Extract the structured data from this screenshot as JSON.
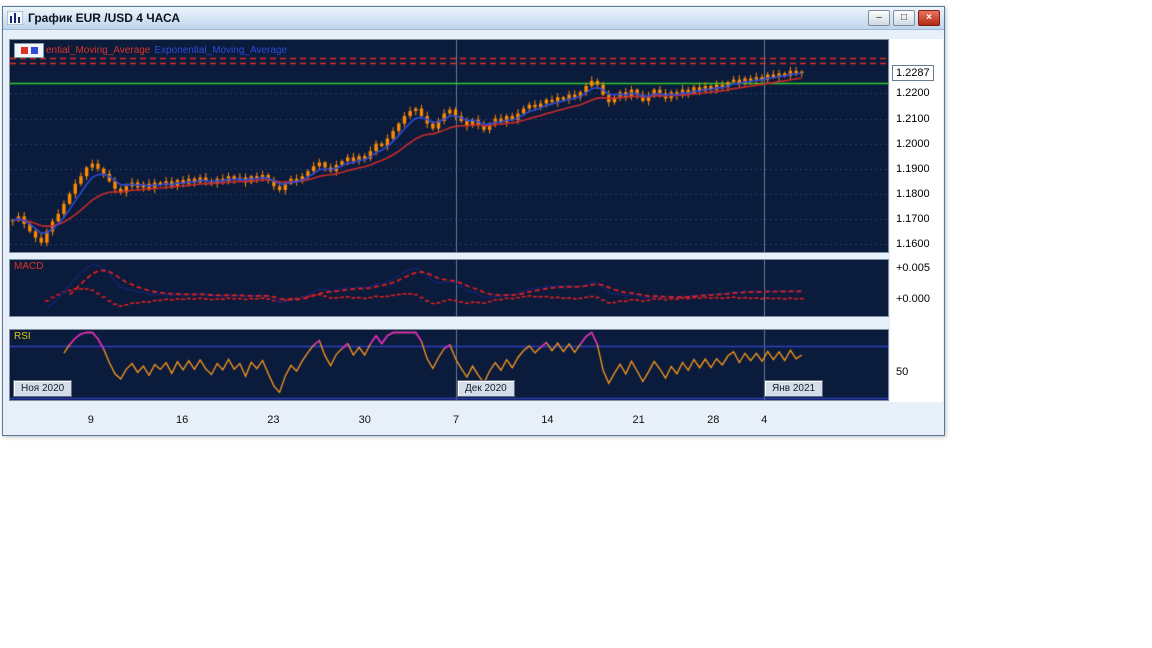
{
  "window": {
    "title": "График EUR /USD 4 ЧАСА",
    "controls": {
      "minimize": "–",
      "maximize": "□",
      "close": "×"
    }
  },
  "legend": {
    "red_label": "ential_Moving_Average",
    "blue_label": "Exponential_Moving_Average"
  },
  "panels": {
    "macd_label": "MACD",
    "rsi_label": "RSI"
  },
  "date_buttons": [
    {
      "label": "Ноя 2020"
    },
    {
      "label": "Дек 2020"
    },
    {
      "label": "Янв 2021"
    }
  ],
  "chart_data": [
    {
      "type": "candlestick",
      "title": "EUR/USD 4 часа",
      "ylim": [
        1.1568,
        1.2413
      ],
      "price_axis_labels": [
        {
          "label": "1.2287",
          "value": 1.2287,
          "current": true
        },
        {
          "label": "1.2200",
          "value": 1.22
        },
        {
          "label": "1.2100",
          "value": 1.21
        },
        {
          "label": "1.2000",
          "value": 1.2
        },
        {
          "label": "1.1900",
          "value": 1.19
        },
        {
          "label": "1.1800",
          "value": 1.18
        },
        {
          "label": "1.1700",
          "value": 1.17
        },
        {
          "label": "1.1600",
          "value": 1.16
        }
      ],
      "hlines": [
        {
          "value": 1.234,
          "color": "#e03127",
          "style": "dashed"
        },
        {
          "value": 1.232,
          "color": "#e03127",
          "style": "dashed"
        },
        {
          "value": 1.2243,
          "color": "#2fca2f",
          "style": "solid"
        }
      ],
      "month_line_fractions": [
        0.508,
        0.859
      ],
      "candles_width_fraction": 0.905,
      "first_open": 1.169,
      "close": [
        1.1695,
        1.171,
        1.168,
        1.165,
        1.1625,
        1.1605,
        1.165,
        1.169,
        1.172,
        1.176,
        1.18,
        1.184,
        1.187,
        1.1905,
        1.192,
        1.19,
        1.188,
        1.185,
        1.182,
        1.1805,
        1.183,
        1.1845,
        1.1825,
        1.184,
        1.182,
        1.1845,
        1.1835,
        1.185,
        1.183,
        1.1855,
        1.184,
        1.186,
        1.1845,
        1.1865,
        1.185,
        1.184,
        1.186,
        1.185,
        1.187,
        1.1855,
        1.1865,
        1.1845,
        1.187,
        1.186,
        1.1875,
        1.1855,
        1.183,
        1.1815,
        1.184,
        1.186,
        1.185,
        1.187,
        1.189,
        1.191,
        1.1925,
        1.1905,
        1.189,
        1.1915,
        1.193,
        1.1945,
        1.193,
        1.195,
        1.194,
        1.197,
        1.2,
        1.199,
        1.202,
        1.205,
        1.208,
        1.211,
        1.213,
        1.214,
        1.211,
        1.208,
        1.206,
        1.209,
        1.212,
        1.2135,
        1.211,
        1.209,
        1.207,
        1.2095,
        1.2075,
        1.2055,
        1.208,
        1.21,
        1.2085,
        1.211,
        1.2095,
        1.212,
        1.214,
        1.2155,
        1.2145,
        1.216,
        1.2175,
        1.2165,
        1.2185,
        1.2175,
        1.2195,
        1.2185,
        1.2205,
        1.223,
        1.225,
        1.2235,
        1.2195,
        1.2165,
        1.2185,
        1.2205,
        1.2185,
        1.2215,
        1.2195,
        1.217,
        1.219,
        1.2215,
        1.22,
        1.218,
        1.2205,
        1.219,
        1.2215,
        1.22,
        1.2225,
        1.221,
        1.223,
        1.2215,
        1.2235,
        1.2225,
        1.2245,
        1.2255,
        1.224,
        1.226,
        1.225,
        1.2265,
        1.2255,
        1.2275,
        1.2265,
        1.228,
        1.227,
        1.229,
        1.228,
        1.2287
      ],
      "x_ticks": [
        {
          "label": "9",
          "f": 0.092
        },
        {
          "label": "16",
          "f": 0.196
        },
        {
          "label": "23",
          "f": 0.3
        },
        {
          "label": "30",
          "f": 0.404
        },
        {
          "label": "7",
          "f": 0.508
        },
        {
          "label": "14",
          "f": 0.612
        },
        {
          "label": "21",
          "f": 0.716
        },
        {
          "label": "28",
          "f": 0.801
        },
        {
          "label": "4",
          "f": 0.859
        }
      ],
      "colors": {
        "bg": "#0a1b3c",
        "candle": "#ff8a00",
        "ema_fast": "#2e4bd8",
        "ema_slow": "#cc2b2b",
        "grid": "rgba(80,110,170,0.40)",
        "month_line": "rgba(185,200,220,0.55)"
      }
    },
    {
      "type": "line",
      "title": "MACD",
      "ylim": [
        -0.00281,
        0.00625
      ],
      "axis_labels": [
        {
          "label": "+0.005",
          "value": 0.005
        },
        {
          "label": "+0.000",
          "value": 0.0
        }
      ],
      "colors": {
        "main": "#16246e",
        "signal": "#e02020"
      }
    },
    {
      "type": "line",
      "title": "RSI",
      "ylim": [
        28.5,
        81.9
      ],
      "levels": [
        70,
        30
      ],
      "axis_labels": [
        {
          "label": "50",
          "value": 50
        }
      ],
      "colors": {
        "line": "#ff9a1a",
        "level": "#2f3fbf",
        "overbought": "#e020d0"
      }
    }
  ]
}
